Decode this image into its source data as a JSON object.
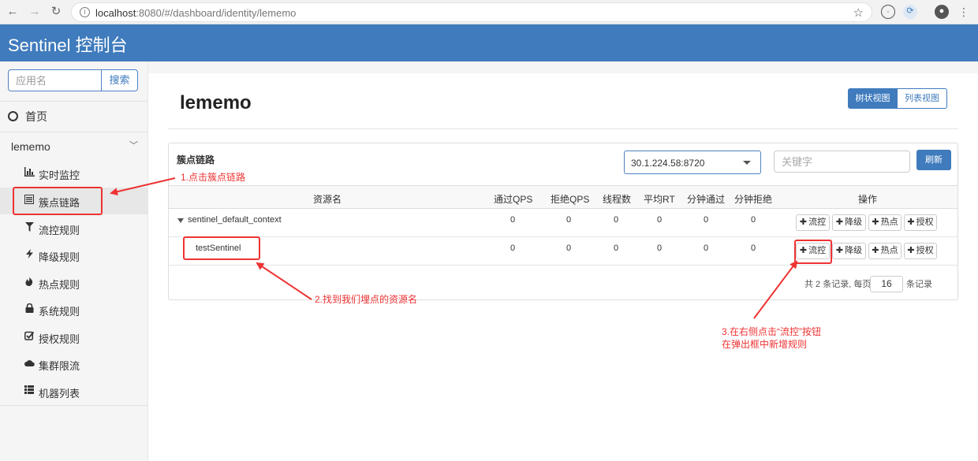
{
  "browser": {
    "url_host": "localhost",
    "url_rest": ":8080/#/dashboard/identity/lememo"
  },
  "app": {
    "title": "Sentinel 控制台"
  },
  "sidebar": {
    "search_placeholder": "应用名",
    "search_button": "搜索",
    "home": "首页",
    "app_name": "lememo",
    "items": [
      {
        "label": "实时监控",
        "icon": "bar-chart-icon",
        "active": false
      },
      {
        "label": "簇点链路",
        "icon": "list-icon",
        "active": true
      },
      {
        "label": "流控规则",
        "icon": "filter-icon",
        "active": false
      },
      {
        "label": "降级规则",
        "icon": "flash-icon",
        "active": false
      },
      {
        "label": "热点规则",
        "icon": "fire-icon",
        "active": false
      },
      {
        "label": "系统规则",
        "icon": "lock-icon",
        "active": false
      },
      {
        "label": "授权规则",
        "icon": "check-icon",
        "active": false
      },
      {
        "label": "集群限流",
        "icon": "cloud-icon",
        "active": false
      },
      {
        "label": "机器列表",
        "icon": "th-list-icon",
        "active": false
      }
    ]
  },
  "main": {
    "title": "lememo",
    "view_tree": "树状视图",
    "view_list": "列表视图",
    "panel_title": "簇点链路",
    "machine": "30.1.224.58:8720",
    "keyword_placeholder": "关键字",
    "refresh": "刷新",
    "columns": [
      "资源名",
      "通过QPS",
      "拒绝QPS",
      "线程数",
      "平均RT",
      "分钟通过",
      "分钟拒绝",
      "操作"
    ],
    "rows": [
      {
        "name": "sentinel_default_context",
        "values": [
          "0",
          "0",
          "0",
          "0",
          "0",
          "0"
        ]
      },
      {
        "name": "testSentinel",
        "values": [
          "0",
          "0",
          "0",
          "0",
          "0",
          "0"
        ]
      }
    ],
    "ops": [
      "流控",
      "降级",
      "热点",
      "授权"
    ],
    "pager_prefix": "共 2 条记录, 每页",
    "page_size": "16",
    "pager_suffix": "条记录"
  },
  "annotations": {
    "step1": "1.点击簇点链路",
    "step2": "2.找到我们埋点的资源名",
    "step3_line1": "3.在右侧点击“流控”按钮",
    "step3_line2": "在弹出框中新增规则",
    "color": "#e33333"
  }
}
